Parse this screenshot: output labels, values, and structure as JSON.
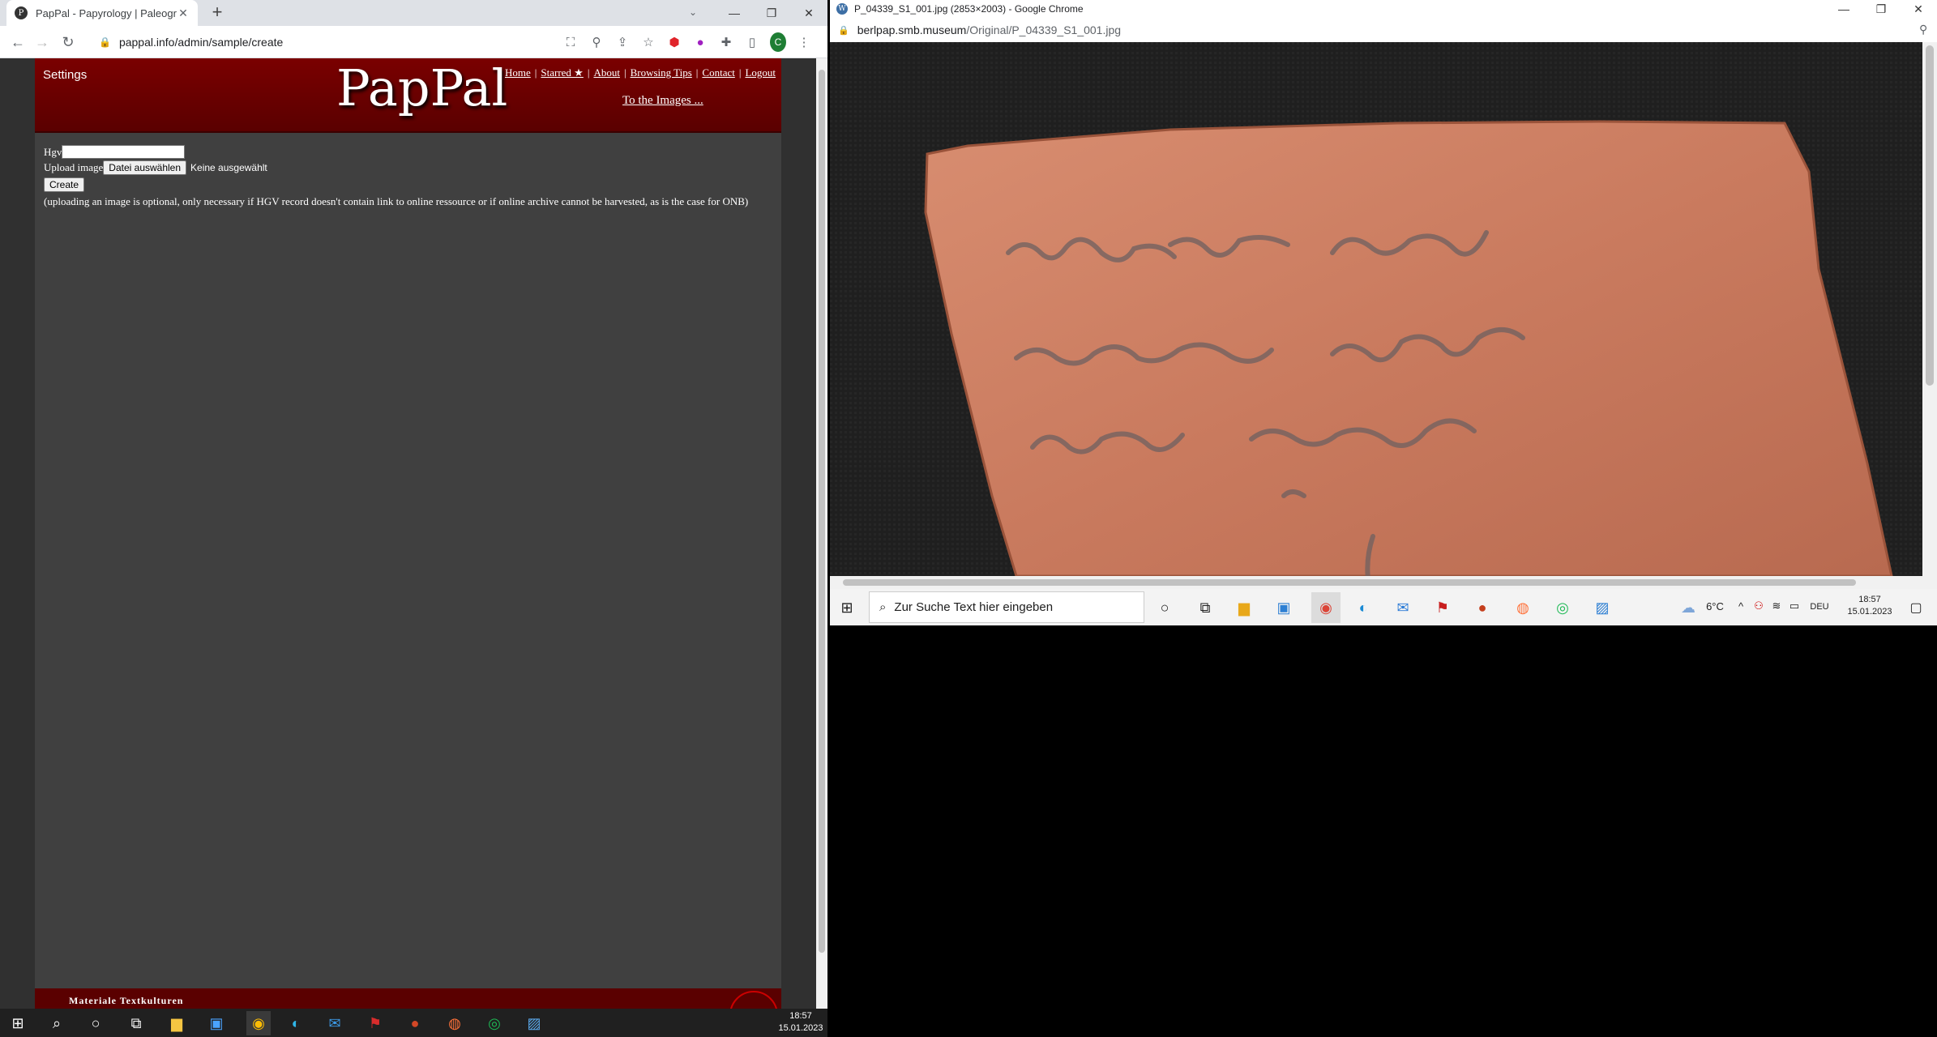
{
  "left_window": {
    "tab_title": "PapPal - Papyrology | Paleograph",
    "tab_favicon": "P",
    "new_tab": "+",
    "url": "pappal.info/admin/sample/create",
    "profile_letter": "C"
  },
  "site": {
    "settings": "Settings",
    "logo": "PapPal",
    "nav": [
      "Home",
      "Starred ★",
      "About",
      "Browsing Tips",
      "Contact",
      "Logout"
    ],
    "nav_separator": "|",
    "images_link": "To the Images ...",
    "form": {
      "hgv_label": "Hgv",
      "hgv_value": "",
      "upload_label": "Upload image",
      "file_button": "Datei auswählen",
      "file_status": "Keine ausgewählt",
      "create_button": "Create",
      "note": "(uploading an image is optional, only necessary if HGV record doesn't contain link to online ressource or if online archive cannot be harvested, as is the case for ONB)"
    },
    "footer_text": "Materiale Textkulturen"
  },
  "right_window": {
    "title": "P_04339_S1_001.jpg (2853×2003) - Google Chrome",
    "url_host": "berlpap.smb.museum",
    "url_path": "/Original/P_04339_S1_001.jpg"
  },
  "right_taskbar": {
    "search_placeholder": "Zur Suche Text hier eingeben",
    "temperature": "6°C",
    "language": "DEU",
    "time": "18:57",
    "date": "15.01.2023"
  },
  "left_taskbar": {
    "time": "18:57",
    "date": "15.01.2023"
  },
  "colors": {
    "site_header": "#6b0000",
    "site_body": "#404040",
    "ostracon": "#c97a5e"
  }
}
